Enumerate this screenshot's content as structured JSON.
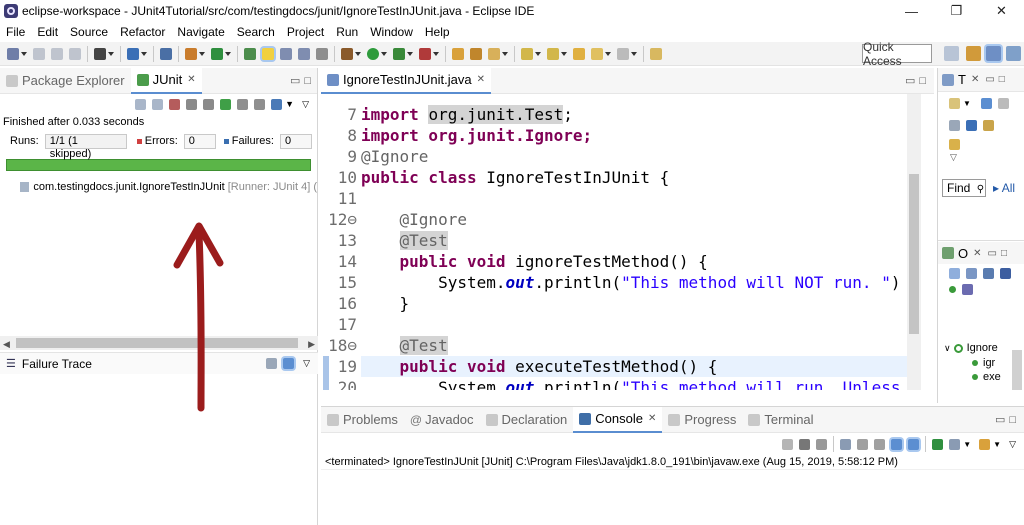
{
  "window": {
    "title": "eclipse-workspace - JUnit4Tutorial/src/com/testingdocs/junit/IgnoreTestInJUnit.java - Eclipse IDE",
    "minimize": "—",
    "maximize": "❐",
    "close": "✕"
  },
  "menu": [
    "File",
    "Edit",
    "Source",
    "Refactor",
    "Navigate",
    "Search",
    "Project",
    "Run",
    "Window",
    "Help"
  ],
  "toolbar": {
    "quick_access": "Quick Access"
  },
  "left": {
    "tabs": [
      {
        "label": "Package Explorer"
      },
      {
        "label": "JUnit"
      }
    ],
    "status": "Finished after 0.033 seconds",
    "runs_label": "Runs:",
    "runs_value": "1/1 (1 skipped)",
    "errors_label": "Errors:",
    "errors_value": "0",
    "failures_label": "Failures:",
    "failures_value": "0",
    "progress": 1.0,
    "tree_item": "com.testingdocs.junit.IgnoreTestInJUnit",
    "tree_runner": "[Runner: JUnit 4] (",
    "failure_trace": "Failure Trace"
  },
  "editor": {
    "tab": "IgnoreTestInJUnit.java",
    "lines": [
      {
        "n": "7",
        "segs": [
          {
            "t": "import ",
            "c": "kw"
          },
          {
            "t": "org.junit.Test",
            "c": "hl"
          },
          {
            "t": ";",
            "c": ""
          }
        ]
      },
      {
        "n": "8",
        "segs": []
      },
      {
        "n": "9",
        "segs": [
          {
            "t": "@Ignore",
            "c": "an"
          }
        ]
      },
      {
        "n": "10",
        "segs": [
          {
            "t": "public class ",
            "c": "kw"
          },
          {
            "t": "IgnoreTestInJUnit {",
            "c": ""
          }
        ]
      },
      {
        "n": "11",
        "segs": []
      },
      {
        "n": "12⊖",
        "segs": [
          {
            "t": "    @Ignore",
            "c": "an"
          }
        ]
      },
      {
        "n": "13",
        "segs": [
          {
            "t": "    ",
            "c": ""
          },
          {
            "t": "@Test",
            "c": "an hl"
          }
        ]
      },
      {
        "n": "14",
        "segs": [
          {
            "t": "    public void ",
            "c": "kw"
          },
          {
            "t": "ignoreTestMethod() {",
            "c": ""
          }
        ]
      },
      {
        "n": "15",
        "segs": [
          {
            "t": "        System.",
            "c": ""
          },
          {
            "t": "out",
            "c": "fld"
          },
          {
            "t": ".println(",
            "c": ""
          },
          {
            "t": "\"This method will NOT run. \"",
            "c": "str"
          },
          {
            "t": ")",
            "c": ""
          }
        ]
      },
      {
        "n": "16",
        "segs": [
          {
            "t": "    }",
            "c": ""
          }
        ]
      },
      {
        "n": "17",
        "segs": []
      },
      {
        "n": "18⊖",
        "segs": [
          {
            "t": "    ",
            "c": ""
          },
          {
            "t": "@Test",
            "c": "an hl"
          }
        ]
      },
      {
        "n": "19",
        "segs": [
          {
            "t": "    public void ",
            "c": "kw"
          },
          {
            "t": "executeTestMethod() {",
            "c": ""
          }
        ]
      },
      {
        "n": "20",
        "segs": [
          {
            "t": "        System.",
            "c": ""
          },
          {
            "t": "out",
            "c": "fld"
          },
          {
            "t": ".println(",
            "c": ""
          },
          {
            "t": "\"This method will run. Unless",
            "c": "str"
          }
        ]
      }
    ],
    "top_partial": "import org.junit.Ignore;"
  },
  "right": {
    "tab1": "T",
    "tab2": "O",
    "find_label": "Find",
    "all_label": "All",
    "outline_item1": "Ignore",
    "outline_item2": "igr",
    "outline_item3": "exe"
  },
  "console": {
    "tabs": [
      {
        "label": "Problems"
      },
      {
        "label": "Javadoc"
      },
      {
        "label": "Declaration"
      },
      {
        "label": "Console"
      },
      {
        "label": "Progress"
      },
      {
        "label": "Terminal"
      }
    ],
    "line": "<terminated> IgnoreTestInJUnit [JUnit] C:\\Program Files\\Java\\jdk1.8.0_191\\bin\\javaw.exe (Aug 15, 2019, 5:58:12 PM)"
  },
  "colors": {
    "progress_green": "#5bb548",
    "annotation_arrow": "#9b1c1c",
    "keyword": "#7f0055",
    "string": "#2a00ff"
  }
}
